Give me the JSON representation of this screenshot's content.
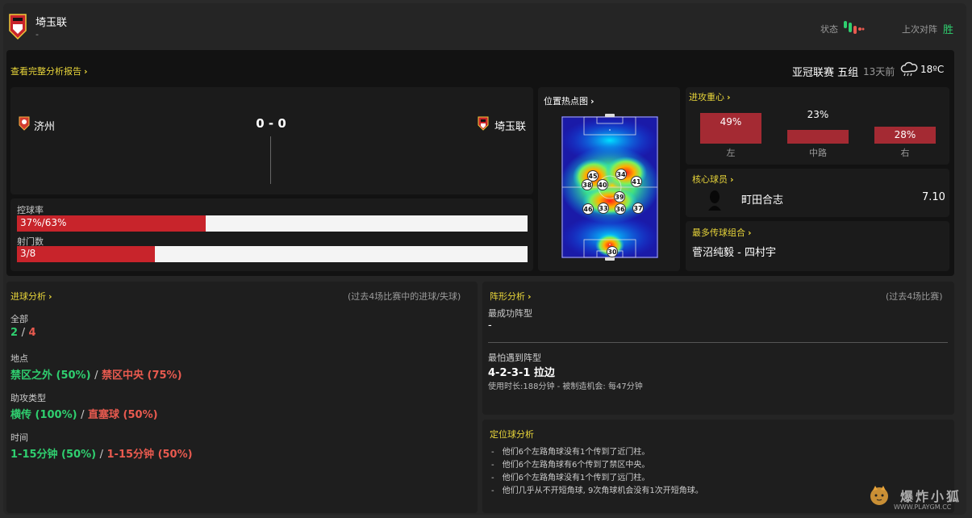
{
  "header": {
    "team_name": "埼玉联",
    "team_sub": "-",
    "form_label": "状态",
    "last_match_label": "上次对阵",
    "last_match_result": "胜"
  },
  "match": {
    "report_link": "查看完整分析报告",
    "competition": "亚冠联赛 五组",
    "time_ago": "13天前",
    "temperature": "18ºC",
    "home_team": "济州",
    "away_team": "埼玉联",
    "score": "0 - 0",
    "possession_label": "控球率",
    "possession_value": "37%/63%",
    "possession_home_fraction": 0.37,
    "shots_label": "射门数",
    "shots_value": "3/8",
    "shots_home_fraction": 0.27
  },
  "heatmap": {
    "title": "位置热点图",
    "players": [
      "45",
      "34",
      "38",
      "40",
      "41",
      "39",
      "46",
      "33",
      "36",
      "37",
      "30"
    ]
  },
  "attack_focus": {
    "title": "进攻重心",
    "zones": [
      {
        "label": "左",
        "value": "49%"
      },
      {
        "label": "中路",
        "value": "23%"
      },
      {
        "label": "右",
        "value": "28%"
      }
    ]
  },
  "key_player": {
    "title": "核心球员",
    "name": "町田合志",
    "rating": "7.10"
  },
  "passing_combo": {
    "title": "最多传球组合",
    "value": "菅沼纯毅 - 四村宇"
  },
  "goals_analysis": {
    "title": "进球分析",
    "note": "(过去4场比赛中的进球/失球)",
    "all_label": "全部",
    "all_scored": "2",
    "all_sep": "/",
    "all_conceded": "4",
    "location_label": "地点",
    "location_a": "禁区之外 (50%)",
    "location_sep": "/",
    "location_b": "禁区中央 (75%)",
    "assist_label": "助攻类型",
    "assist_a": "横传 (100%)",
    "assist_sep": "/",
    "assist_b": "直塞球 (50%)",
    "time_label": "时间",
    "time_a": "1-15分钟 (50%)",
    "time_sep": "/",
    "time_b": "1-15分钟 (50%)"
  },
  "formation": {
    "title": "阵形分析",
    "note": "(过去4场比赛)",
    "best_label": "最成功阵型",
    "best_value": "-",
    "worst_label": "最怕遇到阵型",
    "worst_value": "4-2-3-1 拉边",
    "worst_detail": "使用时长:188分钟 - 被制造机会: 每47分钟"
  },
  "set_pieces": {
    "title": "定位球分析",
    "lines": [
      "他们6个左路角球没有1个传到了近门柱。",
      "他们6个左路角球有6个传到了禁区中央。",
      "他们6个左路角球没有1个传到了远门柱。",
      "他们几乎从不开短角球, 9次角球机会没有1次开短角球。"
    ]
  },
  "watermark": {
    "text": "爆炸小狐",
    "url": "WWW.PLAYGM.CC"
  },
  "colors": {
    "accent": "#e8d53a",
    "positive": "#2fcf6f",
    "negative": "#e95a4f",
    "bar_fill": "#c8242b",
    "zone_fill": "#a42a33"
  }
}
